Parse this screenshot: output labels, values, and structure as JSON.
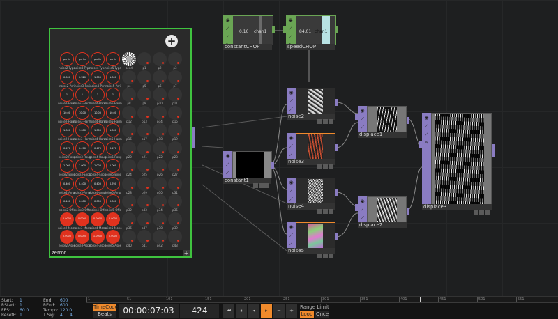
{
  "nodes": {
    "constantCHOP": {
      "label": "constantCHOP",
      "value": "0.16",
      "channel": "chan1"
    },
    "speedCHOP": {
      "label": "speedCHOP",
      "value": "84.01",
      "channel": "chan1"
    },
    "noise2": {
      "label": "noise2"
    },
    "noise3": {
      "label": "noise3"
    },
    "noise4": {
      "label": "noise4"
    },
    "noise5": {
      "label": "noise5"
    },
    "constant1": {
      "label": "constant1"
    },
    "displace1": {
      "label": "displace1"
    },
    "displace2": {
      "label": "displace2"
    },
    "displace3": {
      "label": "displace3"
    },
    "zerror": {
      "label": "zerror",
      "add_glyph": "+",
      "expand_glyph": "+"
    }
  },
  "knob_rows": [
    {
      "labels": [
        "noise2-Type",
        "noise3-Type",
        "noise4-Type",
        "noise5-Type",
        "seed",
        "p1",
        "p2",
        "p3"
      ],
      "values": [
        "perlin",
        "perlin",
        "perlin",
        "perlin",
        "",
        "",
        "",
        ""
      ]
    },
    {
      "labels": [
        "noise2-Peri",
        "noise3-Peri",
        "noise4-Peri",
        "noise5-Peri",
        "p4",
        "p5",
        "p6",
        "p7"
      ],
      "values": [
        "0.500",
        "0.520",
        "1.000",
        "1.000",
        "",
        "",
        "",
        ""
      ]
    },
    {
      "labels": [
        "noise2-Harm",
        "noise3-Harm",
        "noise4-Harm",
        "noise5-Harm",
        "p8",
        "p9",
        "p10",
        "p11"
      ],
      "values": [
        "1",
        "1",
        "1",
        "1",
        "",
        "",
        "",
        ""
      ]
    },
    {
      "labels": [
        "noise2-Harm",
        "noise3-Harm",
        "noise4-Harm",
        "noise5-Harm",
        "p12",
        "p13",
        "p14",
        "p15"
      ],
      "values": [
        "10.00",
        "10.00",
        "10.00",
        "10.00",
        "",
        "",
        "",
        ""
      ]
    },
    {
      "labels": [
        "noise2-Harm",
        "noise3-Harm",
        "noise4-Harm",
        "noise5-Harm",
        "p16",
        "p17",
        "p18",
        "p19"
      ],
      "values": [
        "1.000",
        "1.000",
        "1.000",
        "1.000",
        "",
        "",
        "",
        ""
      ]
    },
    {
      "labels": [
        "noise2-Roug",
        "noise3-Roug",
        "noise4-Roug",
        "noise5-Roug",
        "p20",
        "p21",
        "p22",
        "p23"
      ],
      "values": [
        "0.470",
        "0.470",
        "0.470",
        "0.470",
        "",
        "",
        "",
        ""
      ]
    },
    {
      "labels": [
        "noise2-Expo",
        "noise3-Expo",
        "noise4-Expo",
        "noise5-Expo",
        "p24",
        "p25",
        "p26",
        "p27"
      ],
      "values": [
        "1.000",
        "1.000",
        "1.000",
        "1.000",
        "",
        "",
        "",
        ""
      ]
    },
    {
      "labels": [
        "noise2-Ampl",
        "noise3-Ampl",
        "noise4-Ampl",
        "noise5-Ampl",
        "p28",
        "p29",
        "p30",
        "p31"
      ],
      "values": [
        "0.400",
        "0.400",
        "0.400",
        "0.700",
        "",
        "",
        "",
        ""
      ]
    },
    {
      "labels": [
        "noise2-Offs",
        "noise3-Offs",
        "noise4-Offs",
        "noise5-Offs",
        "p32",
        "p33",
        "p34",
        "p35"
      ],
      "values": [
        "0.100",
        "0.000",
        "0.000",
        "0.000",
        "",
        "",
        "",
        ""
      ]
    },
    {
      "labels": [
        "noise2-Mono",
        "noise3-Mono",
        "noise4-Mono",
        "noise5-Mono",
        "p36",
        "p37",
        "p38",
        "p39"
      ],
      "values": [
        "0.0000",
        "0.0000",
        "0.0000",
        "0.0000",
        "",
        "",
        "",
        ""
      ]
    },
    {
      "labels": [
        "noise2-Aspe",
        "noise3-Aspe",
        "noise4-Aspe",
        "noise5-Aspe",
        "p40",
        "p41",
        "p42",
        "p43"
      ],
      "values": [
        "0.0000",
        "0.0000",
        "1.0000",
        "0.0000",
        "",
        "",
        "",
        ""
      ]
    }
  ],
  "timebar": {
    "start_label": "Start:",
    "start": "1",
    "end_label": "End:",
    "end": "600",
    "rstart_label": "RStart:",
    "rstart": "1",
    "rend_label": "REnd:",
    "rend": "600",
    "fps_label": "FPS:",
    "fps": "60.0",
    "tempo_label": "Tempo:",
    "tempo": "120.0",
    "resetf_label": "ResetF:",
    "resetf": "1",
    "tsig_label": "T Sig:",
    "tsig_a": "4",
    "tsig_b": "4",
    "timecode_label": "TimeCode",
    "beats_label": "Beats",
    "timecode": "00:00:07:03",
    "frame": "424",
    "range_limit_label": "Range Limit",
    "loop_label": "Loop",
    "once_label": "Once",
    "ruler_ticks": [
      "1",
      "51",
      "101",
      "151",
      "201",
      "251",
      "301",
      "351",
      "401",
      "451",
      "501",
      "551"
    ]
  },
  "colors": {
    "accent": "#f08a2c",
    "top_green": "#5ca84a",
    "tex_purple": "#8a7cc2",
    "knob_red": "#e0321e",
    "comp_border": "#3fc33f"
  }
}
